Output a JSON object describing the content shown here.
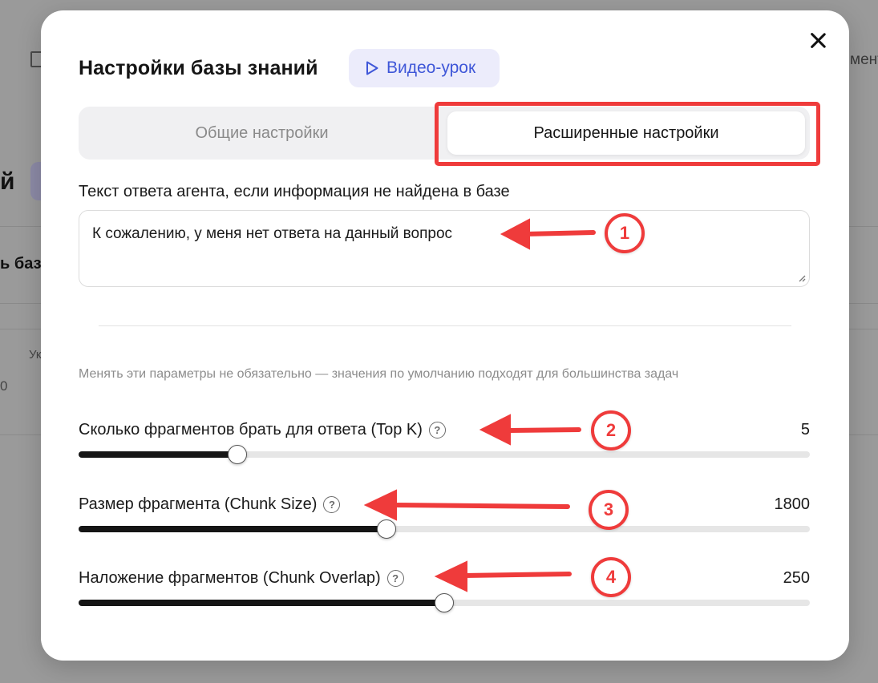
{
  "modal": {
    "title": "Настройки базы знаний",
    "video_button_label": "Видео-урок",
    "tabs": [
      {
        "label": "Общие настройки",
        "active": false
      },
      {
        "label": "Расширенные настройки",
        "active": true
      }
    ],
    "fallback_field": {
      "label": "Текст ответа агента, если информация не найдена в базе",
      "value": "К сожалению, у меня нет ответа на данный вопрос"
    },
    "hint": "Менять эти параметры не обязательно — значения по умолчанию подходят для большинства задач",
    "params": [
      {
        "label": "Сколько фрагментов брать для ответа (Top K)",
        "value": "5",
        "fill_fraction": 0.217
      },
      {
        "label": "Размер фрагмента (Chunk Size)",
        "value": "1800",
        "fill_fraction": 0.421
      },
      {
        "label": "Наложение фрагментов (Chunk Overlap)",
        "value": "250",
        "fill_fraction": 0.5
      }
    ]
  },
  "background": {
    "title_fragment": "й",
    "heading_fragment": "ь базу",
    "col_fragment": "Ук",
    "num_fragment": "0",
    "right_fragment": "мент"
  },
  "annotations": [
    "1",
    "2",
    "3",
    "4"
  ],
  "colors": {
    "accent": "#3f57d8",
    "annotation_red": "#ef3b3b",
    "slider_fill": "#151515"
  }
}
